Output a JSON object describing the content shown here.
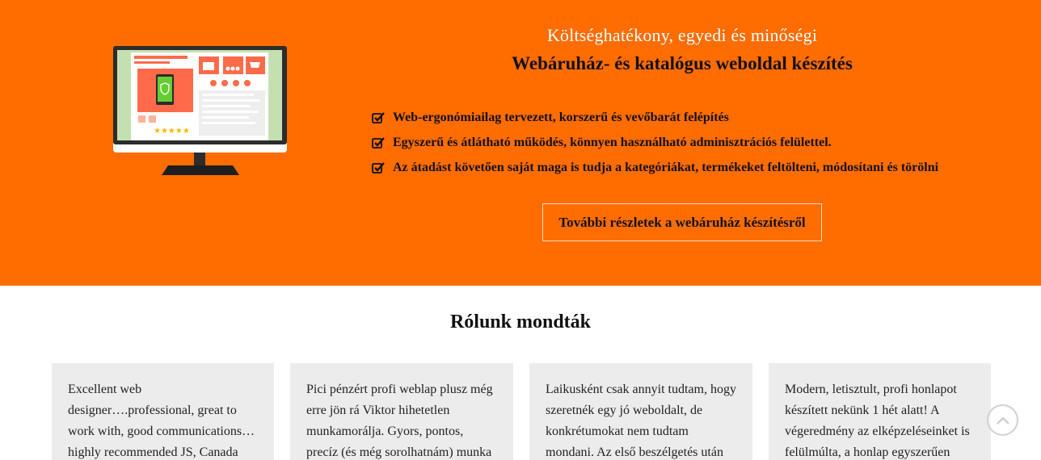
{
  "hero": {
    "subtitle": "Költséghatékony, egyedi és minőségi",
    "title": "Webáruház- és katalógus weboldal készítés",
    "features": [
      "Web-ergonómiailag tervezett, korszerű és vevőbarát felépítés",
      "Egyszerű és átlátható működés, könnyen használható adminisztrációs felülettel.",
      "Az átadást követően saját maga is tudja a kategóriákat, termékeket feltölteni, módosítani és törölni"
    ],
    "button_label": "További részletek a webáruház készítésről",
    "illustration": "webshop-monitor-illustration",
    "background_color": "#ff6c00"
  },
  "testimonials": {
    "title": "Rólunk mondták",
    "cards": [
      "Excellent web designer….professional, great to work with, good communications…highly recommended JS, Canada",
      "Pici pénzért profi weblap plusz még erre jön rá Viktor hihetetlen munkamorálja. Gyors, pontos, precíz (és még sorolhatnám) munka",
      "Laikusként csak annyit tudtam, hogy szeretnék egy jó weboldalt, de konkrétumokat nem tudtam mondani. Az első beszélgetés után",
      "Modern, letisztult, profi honlapot készített nekünk 1 hét alatt! A végeredmény az elképzeléseinket is felülmúlta, a honlap egyszerűen"
    ]
  },
  "icons": {
    "feature": "check-square-icon",
    "scroll_top": "chevron-up-icon"
  }
}
